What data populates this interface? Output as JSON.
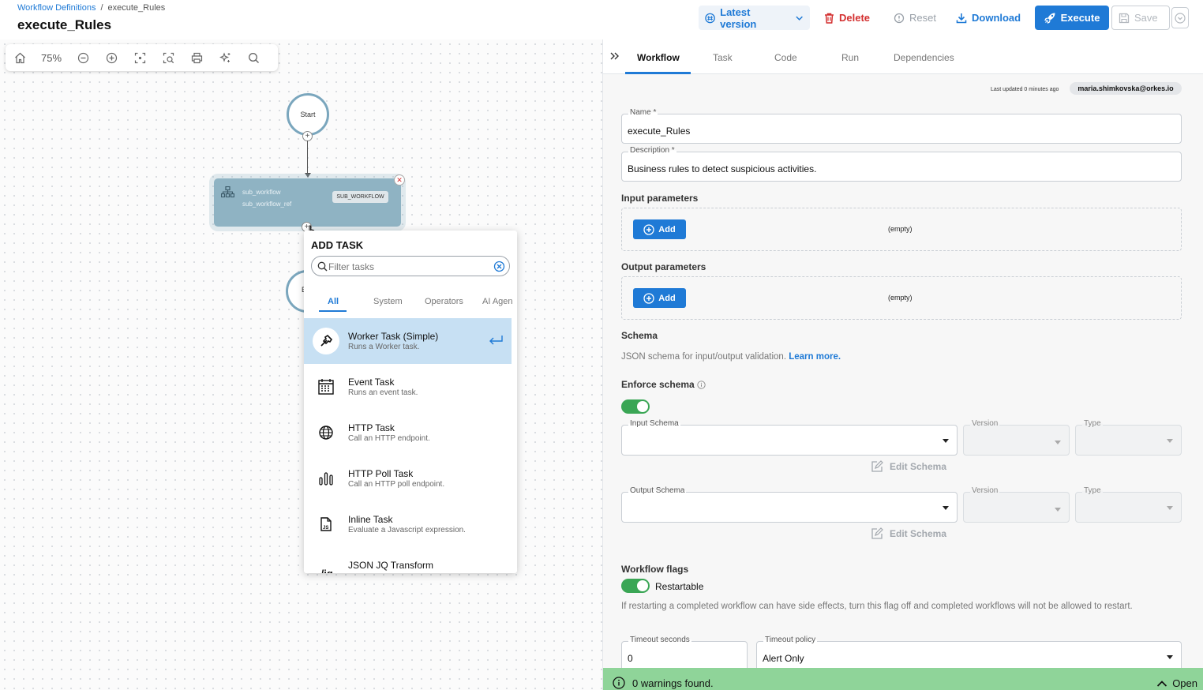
{
  "header": {
    "breadcrumb": {
      "parent": "Workflow Definitions",
      "separator": "/",
      "current": "execute_Rules"
    },
    "title": "execute_Rules",
    "version_label": "Latest version",
    "delete_label": "Delete",
    "reset_label": "Reset",
    "download_label": "Download",
    "execute_label": "Execute",
    "save_label": "Save"
  },
  "canvas": {
    "zoom_label": "75%",
    "start_node_label": "Start",
    "end_node_partial_label": "E",
    "sub_node": {
      "name": "sub_workflow",
      "ref": "sub_workflow_ref",
      "badge": "SUB_WORKFLOW"
    }
  },
  "add_task": {
    "title": "ADD TASK",
    "search_placeholder": "Filter tasks",
    "tabs": [
      "All",
      "System",
      "Operators",
      "AI Agen"
    ],
    "active_tab": "All",
    "tasks": [
      {
        "name": "Worker Task (Simple)",
        "desc": "Runs a Worker task.",
        "icon": "hammer-icon"
      },
      {
        "name": "Event Task",
        "desc": "Runs an event task.",
        "icon": "calendar-icon"
      },
      {
        "name": "HTTP Task",
        "desc": "Call an HTTP endpoint.",
        "icon": "globe-icon"
      },
      {
        "name": "HTTP Poll Task",
        "desc": "Call an HTTP poll endpoint.",
        "icon": "poll-bars-icon"
      },
      {
        "name": "Inline Task",
        "desc": "Evaluate a Javascript expression.",
        "icon": "js-file-icon"
      },
      {
        "name": "JSON JQ Transform",
        "desc": "",
        "icon": "jq-icon"
      }
    ]
  },
  "panel": {
    "tabs": [
      "Workflow",
      "Task",
      "Code",
      "Run",
      "Dependencies"
    ],
    "active_tab": "Workflow",
    "last_updated": "Last updated 0 minutes ago",
    "user": "maria.shimkovska@orkes.io",
    "name": {
      "label": "Name *",
      "value": "execute_Rules"
    },
    "description": {
      "label": "Description *",
      "value": "Business rules to detect suspicious activities."
    },
    "input_params": {
      "title": "Input parameters",
      "add_label": "Add",
      "empty_label": "(empty)"
    },
    "output_params": {
      "title": "Output parameters",
      "add_label": "Add",
      "empty_label": "(empty)"
    },
    "schema": {
      "title": "Schema",
      "description": "JSON schema for input/output validation.",
      "learn_more": "Learn more.",
      "enforce_label": "Enforce schema",
      "enforce_on": true,
      "input_schema_label": "Input Schema",
      "output_schema_label": "Output Schema",
      "version_label": "Version",
      "type_label": "Type",
      "edit_schema_label": "Edit Schema"
    },
    "flags": {
      "title": "Workflow flags",
      "restartable_label": "Restartable",
      "restartable_on": true,
      "restartable_help": "If restarting a completed workflow can have side effects, turn this flag off and completed workflows will not be allowed to restart."
    },
    "timeout_seconds": {
      "label": "Timeout seconds",
      "value": "0"
    },
    "timeout_policy": {
      "label": "Timeout policy",
      "value": "Alert Only"
    },
    "status": {
      "text": "0 warnings found.",
      "open_label": "Open"
    }
  },
  "colors": {
    "accent": "#1f7ad6",
    "danger": "#d32f2f",
    "toggle_on": "#3aa655",
    "status_bar": "#8fd499",
    "node_fill": "#8fb3c3",
    "selected_row": "#c7e0f3"
  }
}
